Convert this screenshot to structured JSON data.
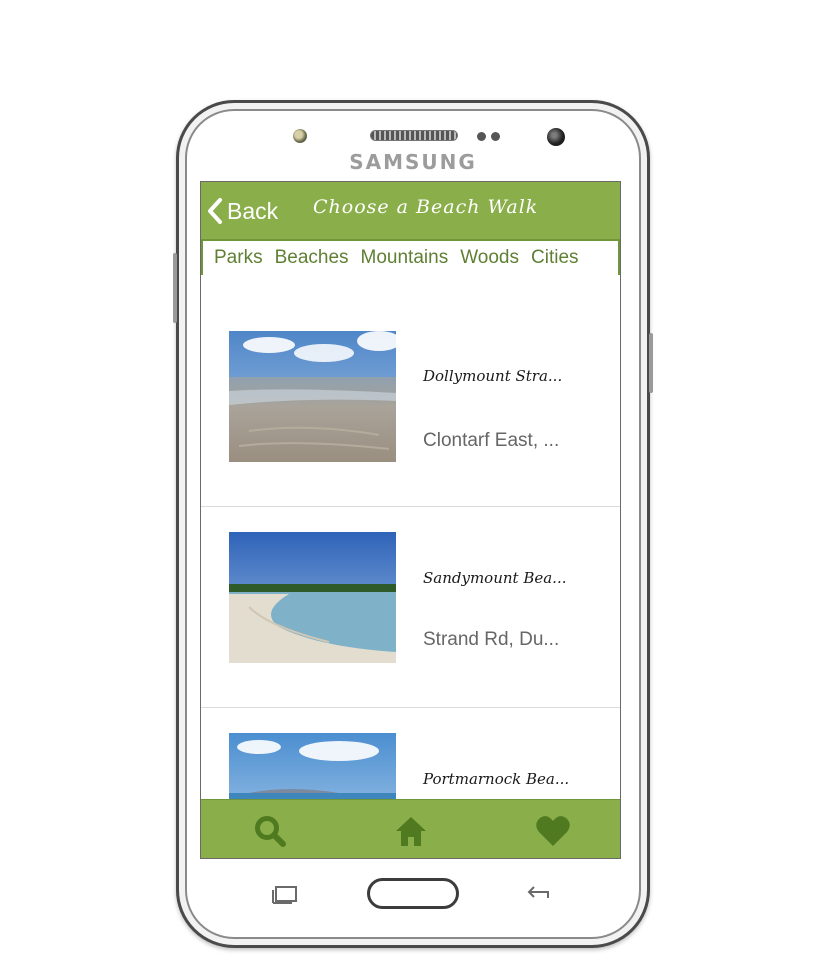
{
  "device": {
    "brand": "SAMSUNG"
  },
  "header": {
    "back_label": "Back",
    "title": "Choose a Beach Walk"
  },
  "tabs": [
    {
      "label": "Parks"
    },
    {
      "label": "Beaches"
    },
    {
      "label": "Mountains"
    },
    {
      "label": "Woods"
    },
    {
      "label": "Cities"
    }
  ],
  "items": [
    {
      "name": "Dollymount Stra...",
      "address": "Clontarf East, ..."
    },
    {
      "name": "Sandymount Bea...",
      "address": "Strand Rd, Du..."
    },
    {
      "name": "Portmarnock Bea...",
      "address": ""
    }
  ],
  "bottom_nav": [
    {
      "icon": "search-icon"
    },
    {
      "icon": "home-icon"
    },
    {
      "icon": "heart-icon"
    }
  ],
  "colors": {
    "accent": "#8aae4a",
    "accent_dark": "#5f7f33"
  }
}
